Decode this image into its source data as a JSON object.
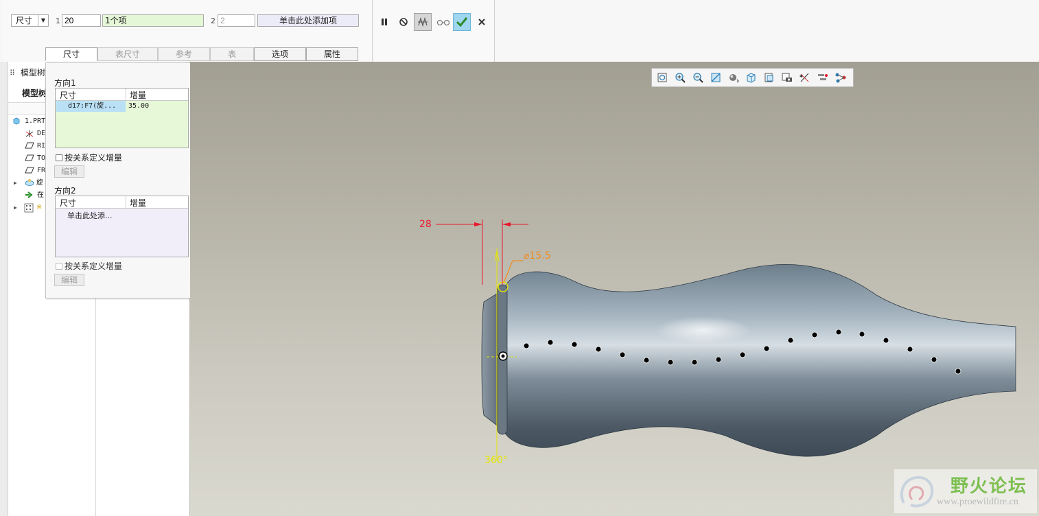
{
  "dashboard": {
    "dim_select": "尺寸",
    "dir1_num": "1",
    "dir1_count": "20",
    "dir1_items": "1个项",
    "dir2_num": "2",
    "dir2_count": "2",
    "dir2_add": "单击此处添加项",
    "tabs": [
      "尺寸",
      "表尺寸",
      "参考",
      "表",
      "选项",
      "属性"
    ]
  },
  "model_tree": {
    "title": "模型树",
    "column_header": "模型树",
    "rows": [
      "1.PRT",
      "DEF",
      "RIG",
      "TOP",
      "FRO",
      "旋",
      "在",
      "※"
    ]
  },
  "popup": {
    "dir1_title": "方向1",
    "col_dim": "尺寸",
    "col_inc": "增量",
    "dir1_row_dim": "d17:F7(旋...",
    "dir1_row_inc": "35.00",
    "rel_checkbox": "按关系定义增量",
    "edit_btn": "编辑",
    "dir2_title": "方向2",
    "dir2_placeholder": "单击此处添...",
    "rel_checkbox2": "按关系定义增量",
    "edit_btn2": "编辑"
  },
  "viewport": {
    "dim_28": "28",
    "dim_diameter": "⌀15.5",
    "dim_angle": "360°"
  },
  "watermark": {
    "cn": "野火论坛",
    "url": "www.proewildfire.cn"
  },
  "colors": {
    "dimension_red": "#e8192c",
    "dimension_orange": "#f08c1e",
    "axis_yellow": "#e6e600",
    "confirm_green": "#2e8b2e",
    "selection_blue": "#b9e0f5"
  }
}
